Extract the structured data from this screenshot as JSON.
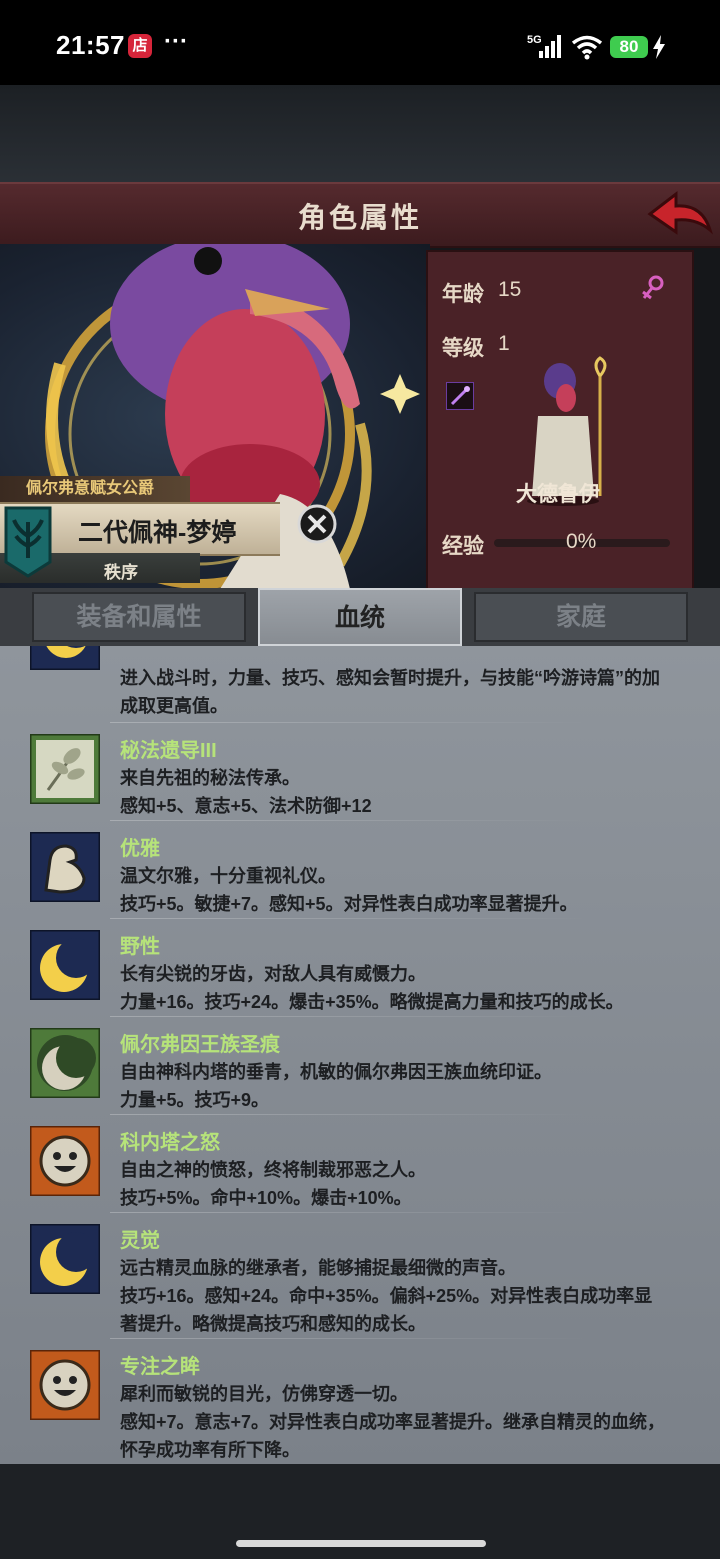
{
  "status_bar": {
    "time": "21:57",
    "store_badge": "店",
    "more": "···",
    "network": "5G",
    "battery": "80",
    "battery_color": "#3fcc4f"
  },
  "header": {
    "title": "角色属性",
    "back_icon": "back-arrow-icon"
  },
  "character": {
    "title_banner": "佩尔弗意赋女公爵",
    "name": "二代佩神-梦婷",
    "faction": "秩序",
    "close_icon": "close-circle-icon"
  },
  "info": {
    "age_label": "年龄",
    "age_value": "15",
    "level_label": "等级",
    "level_value": "1",
    "class_name": "大德鲁伊",
    "exp_label": "经验",
    "exp_value": "0%",
    "exp_progress": 0,
    "gender_icon": "female-icon",
    "class_icon": "staff-icon"
  },
  "tabs": [
    {
      "label": "装备和属性",
      "active": false
    },
    {
      "label": "血统",
      "active": true
    },
    {
      "label": "家庭",
      "active": false
    }
  ],
  "traits": [
    {
      "icon": "moon-icon",
      "title": "",
      "lines": [
        "进入战斗时，力量、技巧、感知会暂时提升，与技能“吟游诗篇”的加",
        "成取更高值。"
      ]
    },
    {
      "icon": "leaf-branch-icon",
      "title": "秘法遗导III",
      "lines": [
        "来自先祖的秘法传承。",
        "感知+5、意志+5、法术防御+12"
      ]
    },
    {
      "icon": "arm-muscle-icon",
      "title": "优雅",
      "lines": [
        "温文尔雅，十分重视礼仪。",
        "技巧+5。敏捷+7。感知+5。对异性表白成功率显著提升。"
      ]
    },
    {
      "icon": "moon-icon",
      "title": "野性",
      "lines": [
        "长有尖锐的牙齿，对敌人具有威慑力。",
        "力量+16。技巧+24。爆击+35%。略微提高力量和技巧的成长。"
      ]
    },
    {
      "icon": "crescent-horn-icon",
      "title": "佩尔弗因王族圣痕",
      "lines": [
        "自由神科内塔的垂青，机敏的佩尔弗因王族血统印证。",
        "力量+5。技巧+9。"
      ]
    },
    {
      "icon": "smiley-sun-icon",
      "title": "科内塔之怒",
      "lines": [
        "自由之神的愤怒，终将制裁邪恶之人。",
        "技巧+5%。命中+10%。爆击+10%。"
      ]
    },
    {
      "icon": "moon-icon",
      "title": "灵觉",
      "lines": [
        "远古精灵血脉的继承者，能够捕捉最细微的声音。",
        "技巧+16。感知+24。命中+35%。偏斜+25%。对异性表白成功率显",
        "著提升。略微提高技巧和感知的成长。"
      ]
    },
    {
      "icon": "smiley-sun-icon",
      "title": "专注之眸",
      "lines": [
        "犀利而敏锐的目光，仿佛穿透一切。",
        "感知+7。意志+7。对异性表白成功率显著提升。继承自精灵的血统，",
        "怀孕成功率有所下降。"
      ]
    }
  ]
}
